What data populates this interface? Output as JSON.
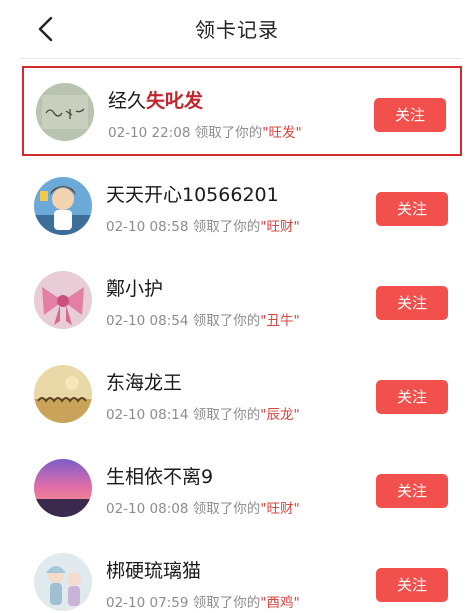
{
  "header": {
    "title": "领卡记录",
    "back_icon": "chevron-left-icon"
  },
  "colors": {
    "accent": "#f2504c",
    "card_text": "#d9453f",
    "highlight_border": "#d42b2b"
  },
  "records": [
    {
      "name": "经久",
      "name_highlight": "失叱发",
      "date": "02-10 22:08",
      "action": "领取了你的",
      "card": "\"旺发\"",
      "button": "关注"
    },
    {
      "name": "天天开心10566201",
      "date": "02-10 08:58",
      "action": "领取了你的",
      "card": "\"旺财\"",
      "button": "关注"
    },
    {
      "name": "鄭小护",
      "date": "02-10 08:54",
      "action": "领取了你的",
      "card": "\"丑牛\"",
      "button": "关注"
    },
    {
      "name": "东海龙王",
      "date": "02-10 08:14",
      "action": "领取了你的",
      "card": "\"辰龙\"",
      "button": "关注"
    },
    {
      "name": "生相依不离9",
      "date": "02-10 08:08",
      "action": "领取了你的",
      "card": "\"旺财\"",
      "button": "关注"
    },
    {
      "name": "梆硬琉璃猫",
      "date": "02-10 07:59",
      "action": "领取了你的",
      "card": "\"酉鸡\"",
      "button": "关注"
    }
  ]
}
